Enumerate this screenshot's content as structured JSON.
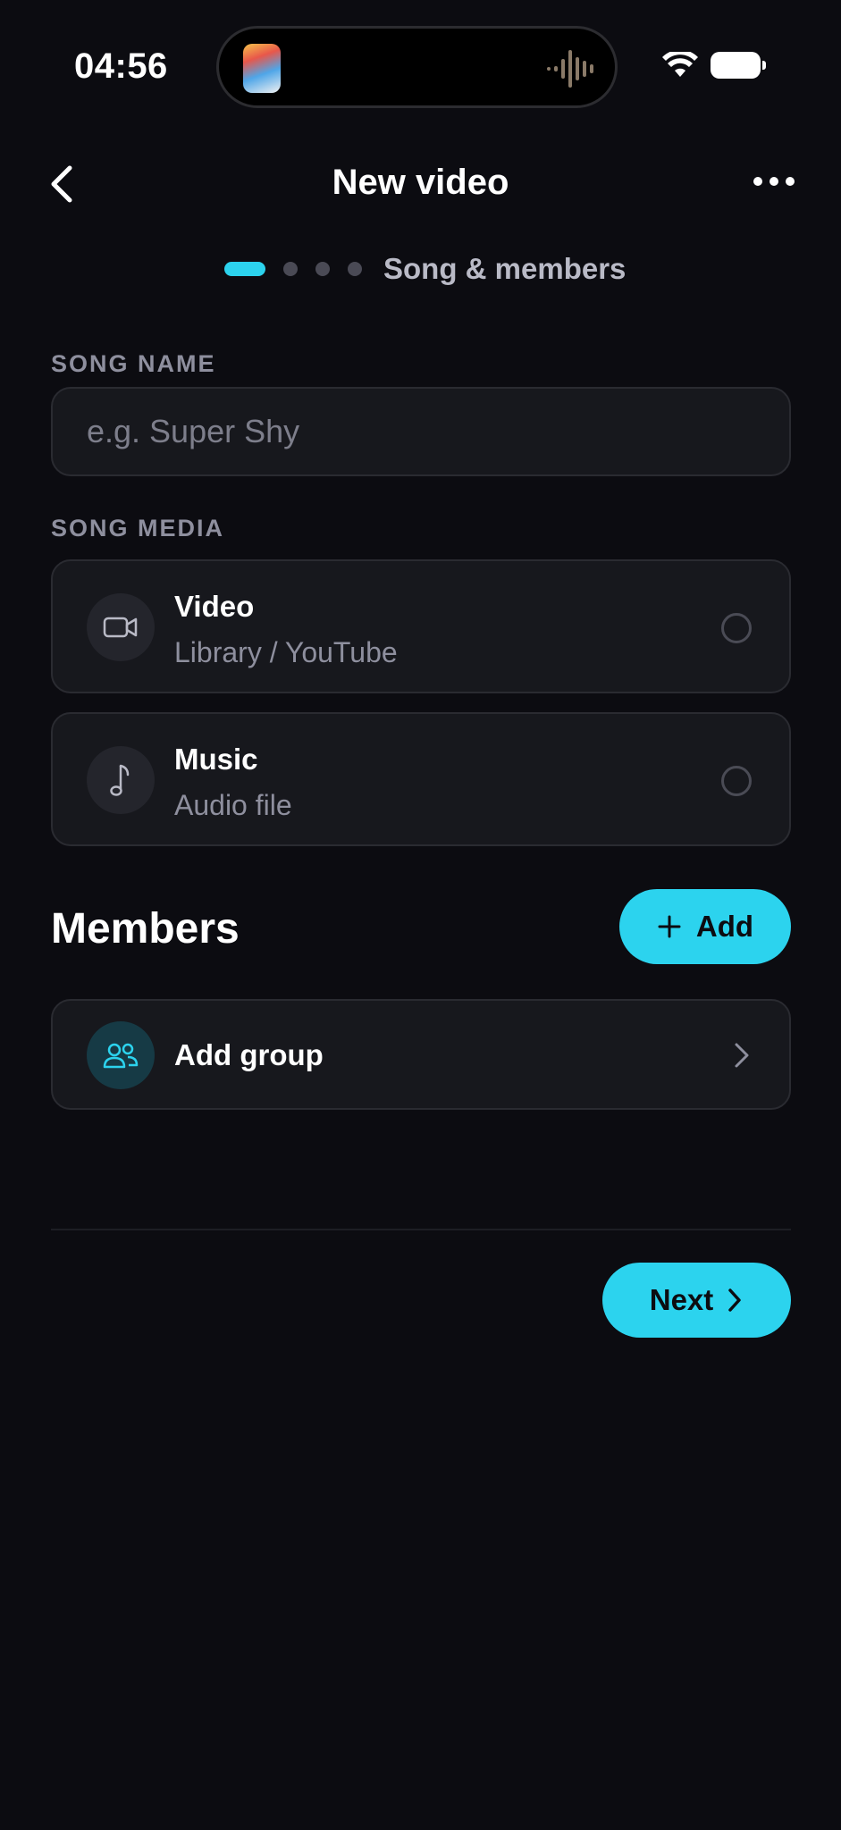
{
  "status_bar": {
    "time": "04:56"
  },
  "header": {
    "title": "New video"
  },
  "stepper": {
    "label": "Song & members",
    "current_step": 1,
    "total_steps": 4
  },
  "song_name": {
    "label": "SONG NAME",
    "placeholder": "e.g. Super Shy",
    "value": ""
  },
  "song_media": {
    "label": "SONG MEDIA",
    "options": [
      {
        "title": "Video",
        "subtitle": "Library / YouTube",
        "icon": "video-camera-icon",
        "selected": false
      },
      {
        "title": "Music",
        "subtitle": "Audio file",
        "icon": "music-note-icon",
        "selected": false
      }
    ]
  },
  "members": {
    "title": "Members",
    "add_label": "Add",
    "group_label": "Add group"
  },
  "footer": {
    "next_label": "Next"
  },
  "colors": {
    "accent": "#2cd3ee",
    "background": "#0c0c11",
    "card": "#17181d"
  }
}
